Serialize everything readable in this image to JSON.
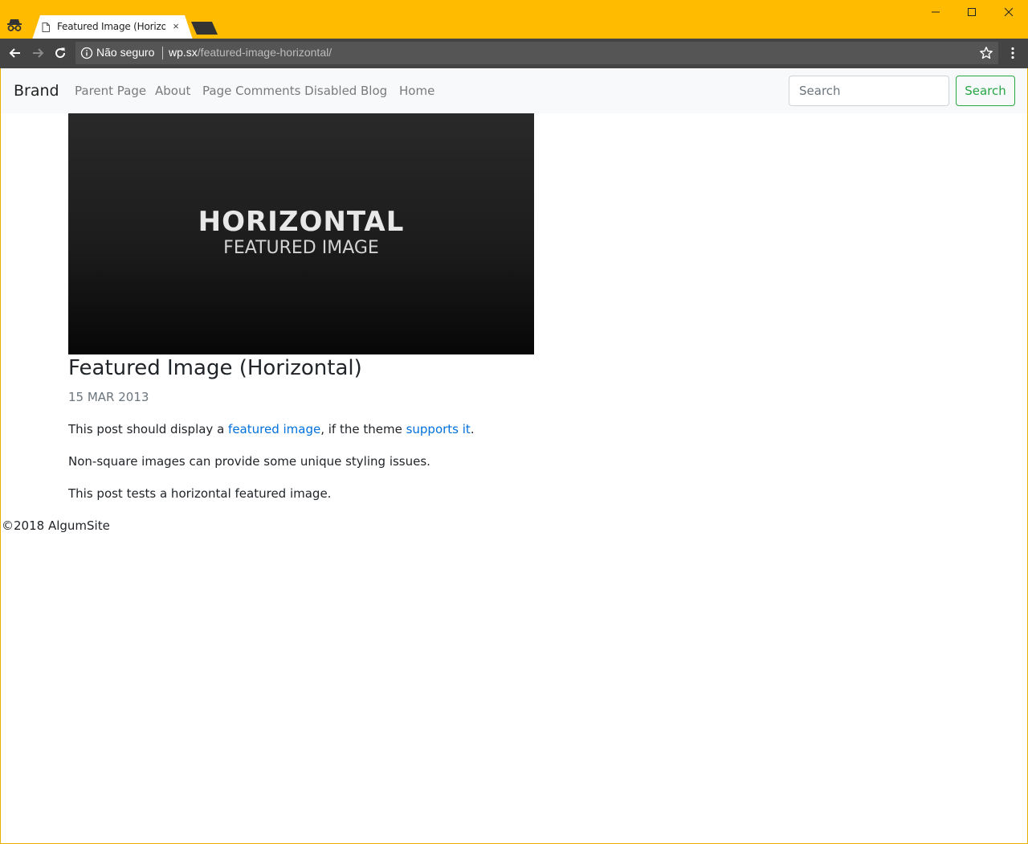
{
  "browser": {
    "tab_title": "Featured Image (Horizontal)",
    "close_glyph": "×",
    "security_label": "Não seguro",
    "url_host": "wp.sx",
    "url_path": "/featured-image-horizontal/",
    "chrome_color": "#ffbb00",
    "toolbar_color": "#444444"
  },
  "navbar": {
    "brand": "Brand",
    "links": [
      "Parent Page",
      "About",
      "Page Comments Disabled",
      "Blog",
      "Home"
    ],
    "search_placeholder": "Search",
    "search_button": "Search",
    "accent_color": "#28a745"
  },
  "post": {
    "image_line1": "HORIZONTAL",
    "image_line2": "FEATURED IMAGE",
    "title": "Featured Image (Horizontal)",
    "date": "15 MAR 2013",
    "p1": {
      "before": "This post should display a ",
      "link1": "featured image",
      "middle": ", if the theme ",
      "link2": "supports it",
      "after": "."
    },
    "p2": "Non-square images can provide some unique styling issues.",
    "p3": "This post tests a horizontal featured image.",
    "link_color": "#0070dd"
  },
  "footer": {
    "text": "©2018 AlgumSite"
  }
}
